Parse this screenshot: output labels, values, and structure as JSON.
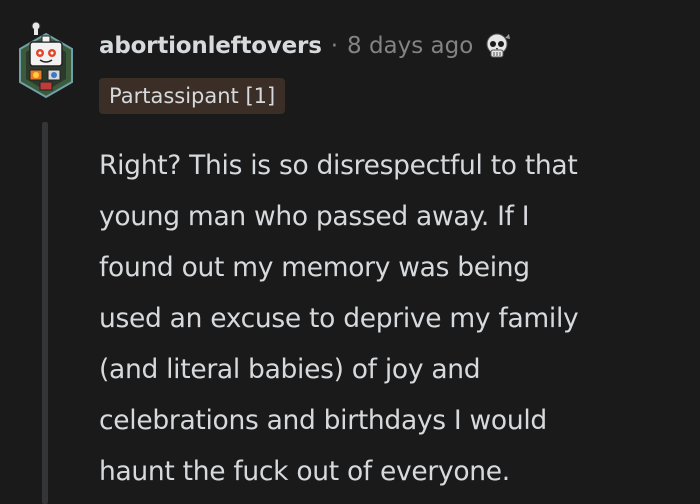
{
  "comment": {
    "username": "abortionleftovers",
    "separator": "·",
    "timestamp": "8 days ago",
    "award_icon": "skull-award-icon",
    "flair": "Partassipant [1]",
    "avatar_icon": "snoo-avatar-icon",
    "body_lines": [
      "Right? This is so disrespectful to that",
      "young man who passed away. If I",
      "found out my memory was being",
      "used an excuse to deprive my family",
      "(and literal babies) of joy and",
      "celebrations and birthdays I would",
      "haunt the fuck out of everyone."
    ]
  },
  "colors": {
    "background": "#1a1a1b",
    "text": "#d7dadc",
    "muted": "#818384",
    "flair_bg": "#3a2e27",
    "thread_line": "#343536"
  }
}
